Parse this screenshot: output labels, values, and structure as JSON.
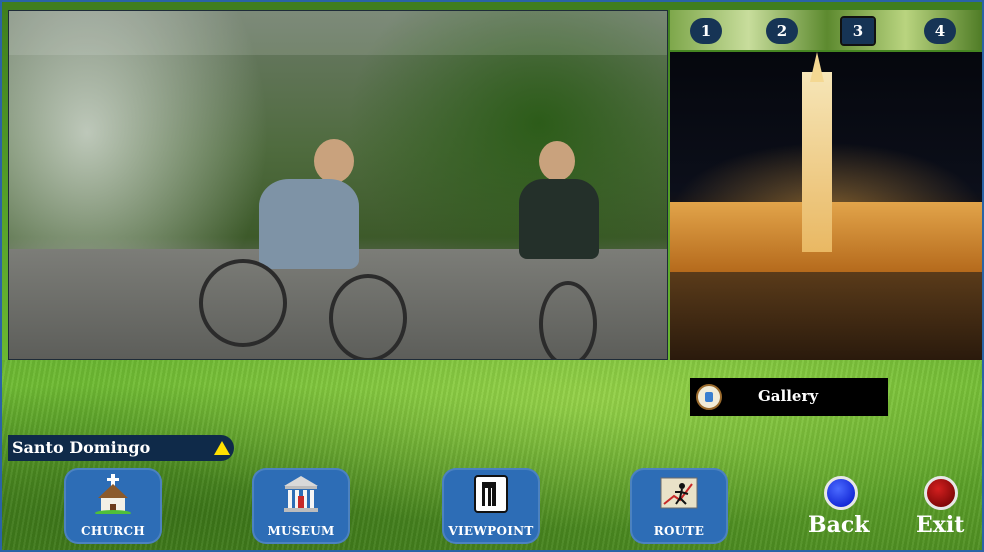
{
  "video": {
    "caption": ""
  },
  "thumbnails": [
    {
      "label": "1"
    },
    {
      "label": "2"
    },
    {
      "label": "3"
    },
    {
      "label": "4"
    }
  ],
  "active_thumbnail": 3,
  "gallery": {
    "label": "Gallery",
    "icon": "camera-icon"
  },
  "location": {
    "label": "Santo Domingo",
    "icon": "triangle-up-icon"
  },
  "nav": [
    {
      "label": "CHURCH",
      "icon": "church-icon"
    },
    {
      "label": "MUSEUM",
      "icon": "museum-icon"
    },
    {
      "label": "VIEWPOINT",
      "icon": "viewpoint-icon"
    },
    {
      "label": "ROUTE",
      "icon": "route-icon"
    }
  ],
  "controls": {
    "back_label": "Back",
    "exit_label": "Exit"
  },
  "colors": {
    "tile_blue": "#2d6db6",
    "thumb_navy": "#163455",
    "location_navy": "#0f2a49",
    "back_button": "#0010c8",
    "exit_button": "#8b0000"
  }
}
